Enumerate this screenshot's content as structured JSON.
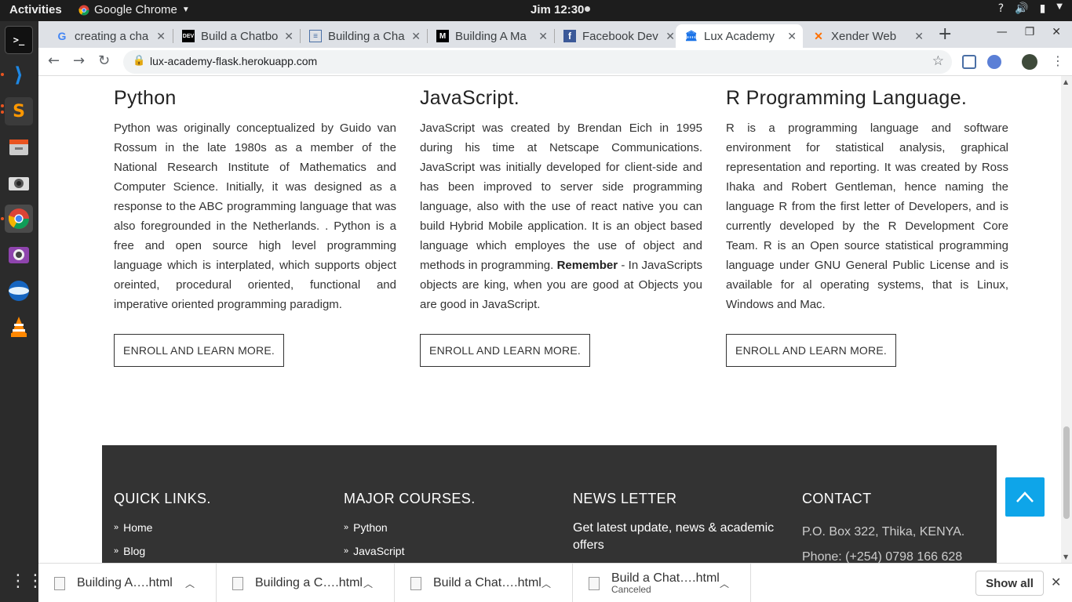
{
  "system": {
    "activities": "Activities",
    "app_menu": "Google Chrome",
    "clock": "Jim 12:30",
    "tray_help": "?",
    "tray_volume": "volume-icon",
    "tray_battery": "battery-icon"
  },
  "tabs": [
    {
      "title": "creating a cha",
      "favicon": "G",
      "favicon_color": "#4285f4"
    },
    {
      "title": "Build a Chatbo",
      "favicon": "DEV",
      "favicon_color": "#000000"
    },
    {
      "title": "Building a Cha",
      "favicon": "≡",
      "favicon_color": "#4a6fa5"
    },
    {
      "title": "Building A Ma",
      "favicon": "M",
      "favicon_color": "#000000"
    },
    {
      "title": "Facebook Dev",
      "favicon": "f",
      "favicon_color": "#3b5998"
    },
    {
      "title": "Lux Academy",
      "favicon": "🏛",
      "favicon_color": "#1a73e8",
      "active": true
    },
    {
      "title": "Xender Web",
      "favicon": "✕",
      "favicon_color": "#ff6f00"
    }
  ],
  "toolbar": {
    "url": "lux-academy-flask.herokuapp.com"
  },
  "courses": [
    {
      "title": "Python",
      "body": "Python was originally conceptualized by Guido van Rossum in the late 1980s as a member of the National Research Institute of Mathematics and Computer Science. Initially, it was designed as a response to the ABC programming language that was also foregrounded in the Netherlands. . Python is a free and open source high level programming language which is interplated, which supports object oreinted, procedural oriented, functional and imperative oriented programming paradigm.",
      "button": "ENROLL AND LEARN MORE."
    },
    {
      "title": "JavaScript.",
      "body_before": "JavaScript was created by Brendan Eich in 1995 during his time at Netscape Communications. JavaScript was initially developed for client-side and has been improved to server side programming language, also with the use of react native you can build Hybrid Mobile application. It is an object based language which employes the use of object and methods in programming. ",
      "body_bold": "Remember",
      "body_after": " - In JavaScripts objects are king, when you are good at Objects you are good in JavaScript.",
      "button": "ENROLL AND LEARN MORE."
    },
    {
      "title": "R Programming Language.",
      "body": "R is a programming language and software environment for statistical analysis, graphical representation and reporting. It was created by Ross Ihaka and Robert Gentleman, hence naming the language R from the first letter of Developers, and is currently developed by the R Development Core Team. R is an Open source statistical programming language under GNU General Public License and is available for al operating systems, that is Linux, Windows and Mac.",
      "button": "ENROLL AND LEARN MORE."
    }
  ],
  "footer": {
    "quick_links": {
      "heading": "QUICK LINKS.",
      "items": [
        "Home",
        "Blog"
      ]
    },
    "major_courses": {
      "heading": "MAJOR COURSES.",
      "items": [
        "Python",
        "JavaScript"
      ]
    },
    "newsletter": {
      "heading": "NEWS LETTER",
      "text": "Get latest update, news & academic offers"
    },
    "contact": {
      "heading": "CONTACT",
      "address": "P.O. Box 322, Thika, KENYA.",
      "phone": "Phone: (+254) 0798 166 628"
    }
  },
  "downloads": [
    {
      "name": "Building A….html",
      "status": ""
    },
    {
      "name": "Building a C….html",
      "status": ""
    },
    {
      "name": "Build a Chat….html",
      "status": ""
    },
    {
      "name": "Build a Chat….html",
      "status": "Canceled"
    }
  ],
  "download_bar": {
    "show_all": "Show all"
  },
  "colors": {
    "footer_bg": "#333333",
    "back_to_top": "#0ea5e9",
    "tabstrip": "#dee1e6"
  }
}
